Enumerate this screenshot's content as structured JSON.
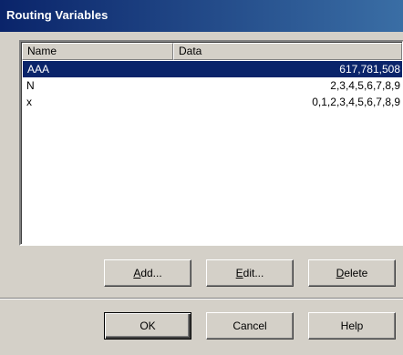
{
  "window": {
    "title": "Routing Variables"
  },
  "list": {
    "columns": {
      "name": "Name",
      "data": "Data"
    },
    "rows": [
      {
        "name": "AAA",
        "data": "617,781,508",
        "selected": true
      },
      {
        "name": "N",
        "data": "2,3,4,5,6,7,8,9",
        "selected": false
      },
      {
        "name": "x",
        "data": "0,1,2,3,4,5,6,7,8,9",
        "selected": false
      }
    ]
  },
  "buttons": {
    "add": {
      "accel": "A",
      "rest": "dd..."
    },
    "edit": {
      "accel": "E",
      "rest": "dit..."
    },
    "delete": {
      "accel": "D",
      "rest": "elete"
    },
    "ok": {
      "label": "OK"
    },
    "cancel": {
      "label": "Cancel"
    },
    "help": {
      "label": "Help"
    }
  },
  "colors": {
    "title_gradient_start": "#0a246a",
    "title_gradient_end": "#3a6ea5",
    "selection": "#0a246a",
    "face": "#d4d0c8"
  }
}
